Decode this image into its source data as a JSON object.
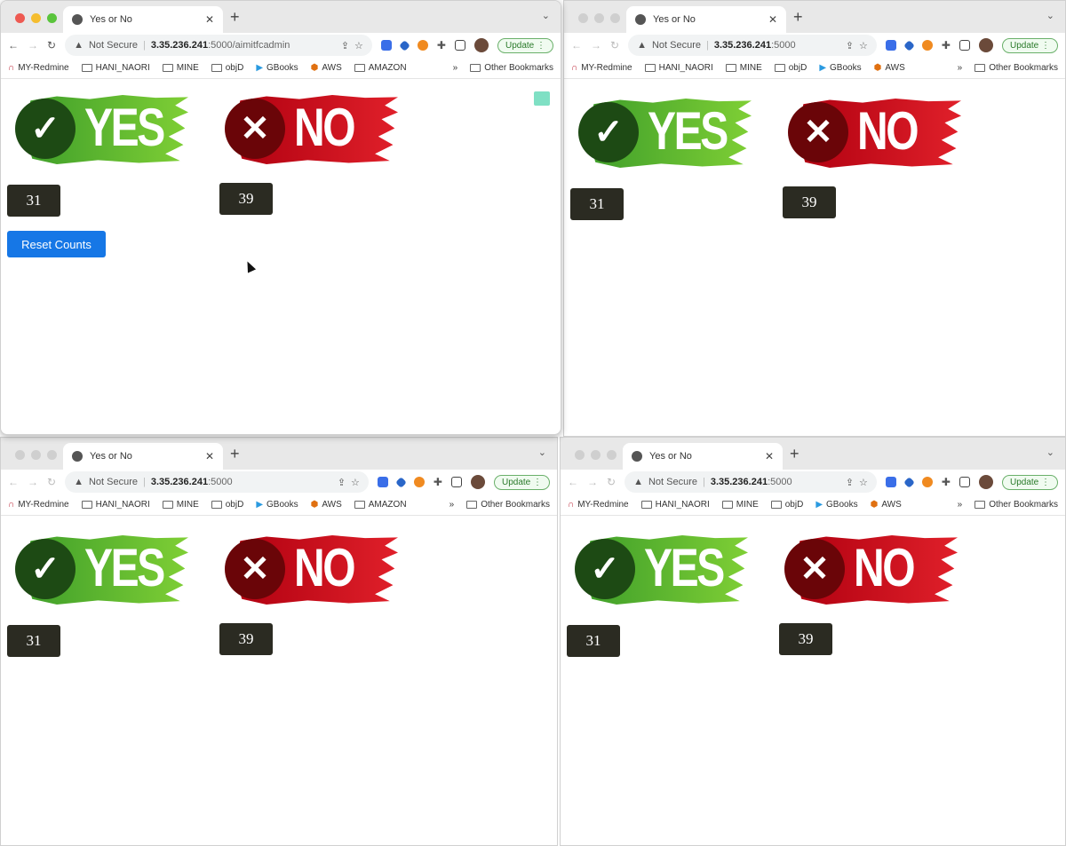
{
  "tab_title": "Yes or No",
  "security_label": "Not Secure",
  "update_label": "Update",
  "yes_label": "YES",
  "no_label": "NO",
  "colors": {
    "accent_blue": "#1677e6",
    "yes_green": "#4caf30",
    "no_red": "#d0101c",
    "count_bg": "#2b2b22"
  },
  "bookmarks_full": [
    "MY-Redmine",
    "HANI_NAORI",
    "MINE",
    "objD",
    "GBooks",
    "AWS",
    "AMAZON"
  ],
  "bookmarks_short": [
    "MY-Redmine",
    "HANI_NAORI",
    "MINE",
    "objD",
    "GBooks",
    "AWS"
  ],
  "more_bookmarks": "»",
  "other_bookmarks": "Other Bookmarks",
  "windows": [
    {
      "host": "3.35.236.241",
      "path": ":5000/aimitfcadmin",
      "yes_count": "31",
      "no_count": "39",
      "reset_label": "Reset Counts",
      "active": true
    },
    {
      "host": "3.35.236.241",
      "path": ":5000",
      "yes_count": "31",
      "no_count": "39",
      "active": false
    },
    {
      "host": "3.35.236.241",
      "path": ":5000",
      "yes_count": "31",
      "no_count": "39",
      "active": false
    },
    {
      "host": "3.35.236.241",
      "path": ":5000",
      "yes_count": "31",
      "no_count": "39",
      "active": false
    }
  ]
}
